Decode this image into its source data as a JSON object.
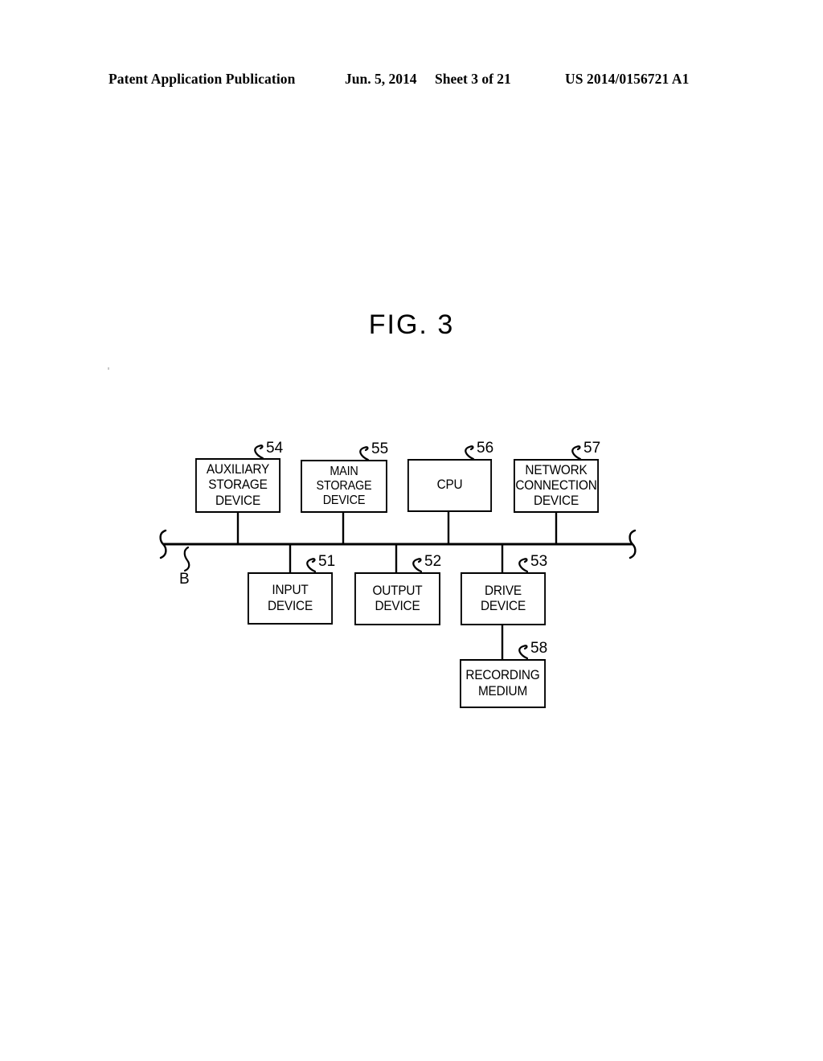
{
  "header": {
    "publication": "Patent Application Publication",
    "date": "Jun. 5, 2014",
    "sheet": "Sheet 3 of 21",
    "patent_number": "US 2014/0156721 A1"
  },
  "figure": {
    "title": "FIG. 3",
    "bus_label": "B",
    "nodes": [
      {
        "id": "auxiliary-storage-device",
        "label": "AUXILIARY\nSTORAGE\nDEVICE",
        "ref": "54"
      },
      {
        "id": "main-storage-device",
        "label": "MAIN STORAGE\nDEVICE",
        "ref": "55"
      },
      {
        "id": "cpu",
        "label": "CPU",
        "ref": "56"
      },
      {
        "id": "network-connection-device",
        "label": "NETWORK\nCONNECTION\nDEVICE",
        "ref": "57"
      },
      {
        "id": "input-device",
        "label": "INPUT DEVICE",
        "ref": "51"
      },
      {
        "id": "output-device",
        "label": "OUTPUT\nDEVICE",
        "ref": "52"
      },
      {
        "id": "drive-device",
        "label": "DRIVE DEVICE",
        "ref": "53"
      },
      {
        "id": "recording-medium",
        "label": "RECORDING\nMEDIUM",
        "ref": "58"
      }
    ]
  },
  "colors": {
    "ink": "#000000",
    "page": "#ffffff"
  }
}
